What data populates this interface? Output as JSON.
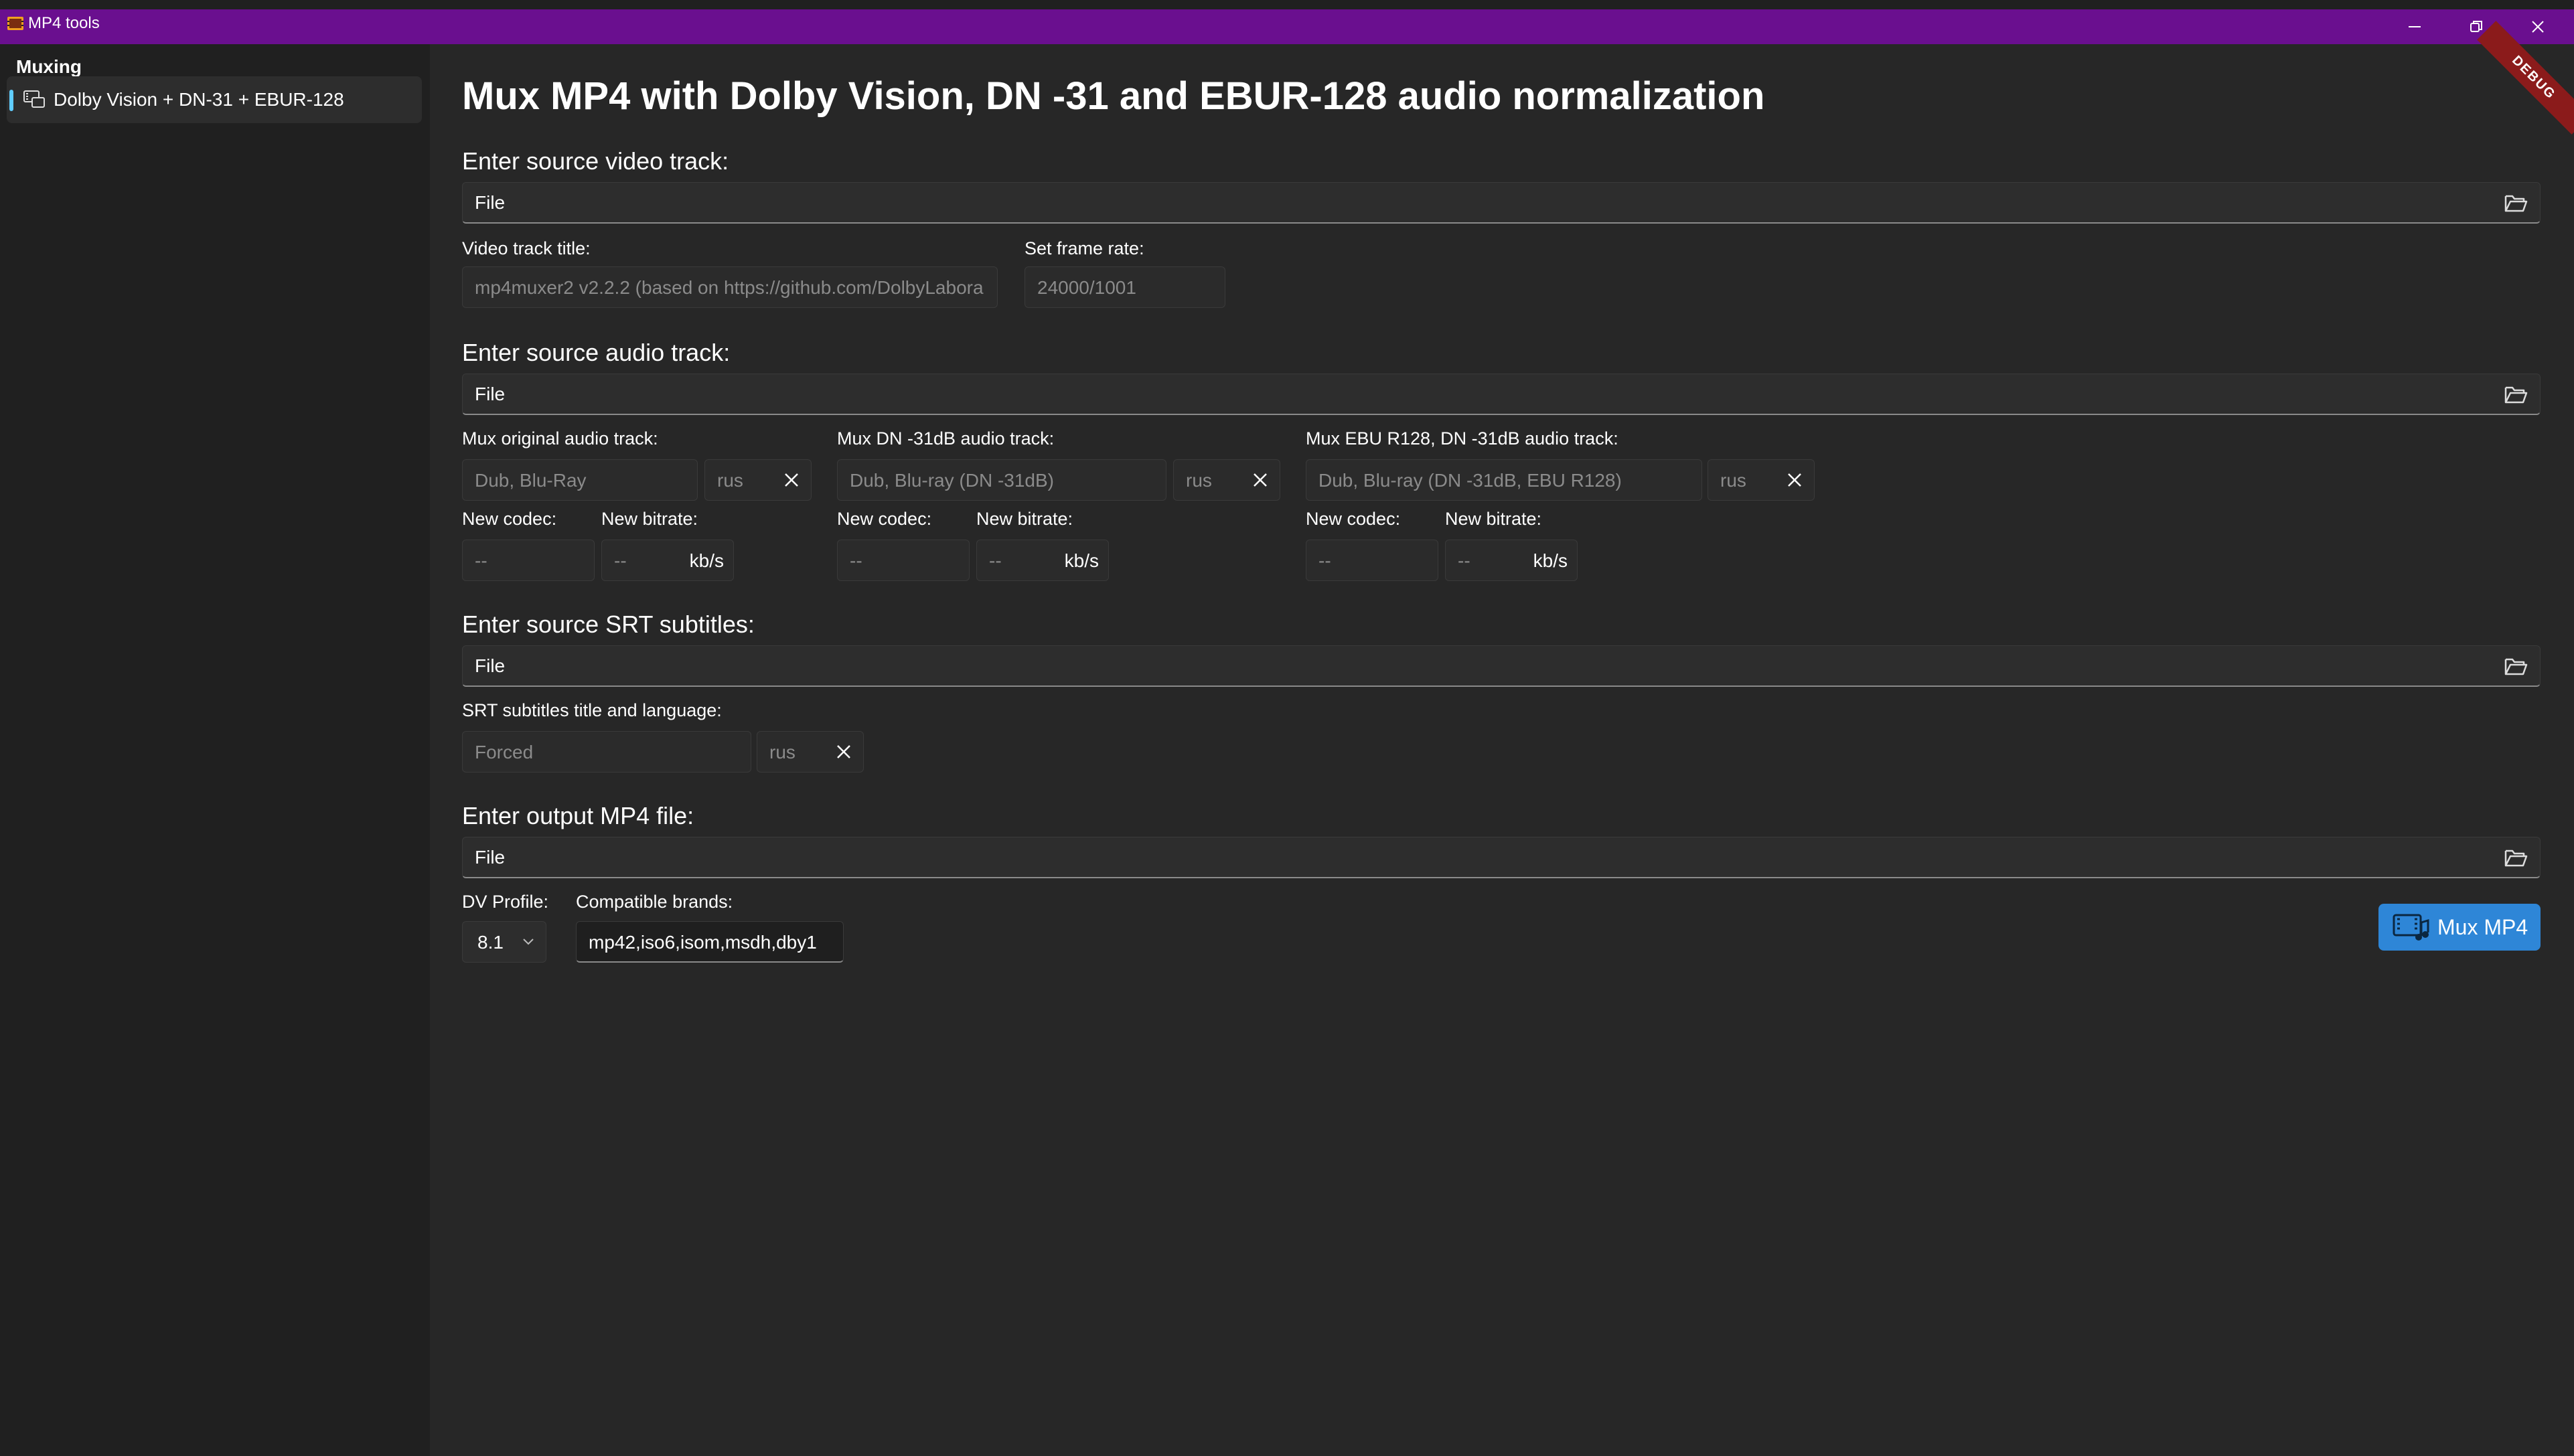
{
  "window": {
    "title": "MP4 tools",
    "accent_color": "#6a0f8f",
    "buttons": [
      "minimize-icon",
      "restore-icon",
      "close-icon"
    ]
  },
  "debug_badge": "DEBUG",
  "sidebar": {
    "header": "Muxing",
    "items": [
      {
        "label": "Dolby Vision + DN-31 + EBUR-128",
        "icon": "video-convert-icon",
        "selected": true
      }
    ]
  },
  "main": {
    "title": "Mux MP4 with Dolby Vision, DN -31 and EBUR-128 audio normalization",
    "video": {
      "section": "Enter source video track:",
      "file_placeholder": "File",
      "title_label": "Video track title:",
      "title_placeholder": "mp4muxer2 v2.2.2 (based on https://github.com/DolbyLabora",
      "fps_label": "Set frame rate:",
      "fps_placeholder": "24000/1001"
    },
    "audio": {
      "section": "Enter source audio track:",
      "file_placeholder": "File",
      "tracks": [
        {
          "label": "Mux original audio track:",
          "title_placeholder": "Dub, Blu-Ray",
          "lang_placeholder": "rus",
          "codec_label": "New codec:",
          "codec_placeholder": "--",
          "bitrate_label": "New bitrate:",
          "bitrate_placeholder": "--",
          "bitrate_unit": "kb/s"
        },
        {
          "label": "Mux DN -31dB audio track:",
          "title_placeholder": "Dub, Blu-ray (DN -31dB)",
          "lang_placeholder": "rus",
          "codec_label": "New codec:",
          "codec_placeholder": "--",
          "bitrate_label": "New bitrate:",
          "bitrate_placeholder": "--",
          "bitrate_unit": "kb/s"
        },
        {
          "label": "Mux EBU R128, DN -31dB audio track:",
          "title_placeholder": "Dub, Blu-ray (DN -31dB, EBU R128)",
          "lang_placeholder": "rus",
          "codec_label": "New codec:",
          "codec_placeholder": "--",
          "bitrate_label": "New bitrate:",
          "bitrate_placeholder": "--",
          "bitrate_unit": "kb/s"
        }
      ]
    },
    "subtitles": {
      "section": "Enter source SRT subtitles:",
      "file_placeholder": "File",
      "label": "SRT subtitles title and language:",
      "title_placeholder": "Forced",
      "lang_placeholder": "rus"
    },
    "output": {
      "section": "Enter output MP4 file:",
      "file_placeholder": "File",
      "dv_profile_label": "DV Profile:",
      "dv_profile_value": "8.1",
      "brands_label": "Compatible brands:",
      "brands_value": "mp42,iso6,isom,msdh,dby1",
      "mux_button": "Mux MP4",
      "mux_button_color": "#2e86d7"
    }
  }
}
